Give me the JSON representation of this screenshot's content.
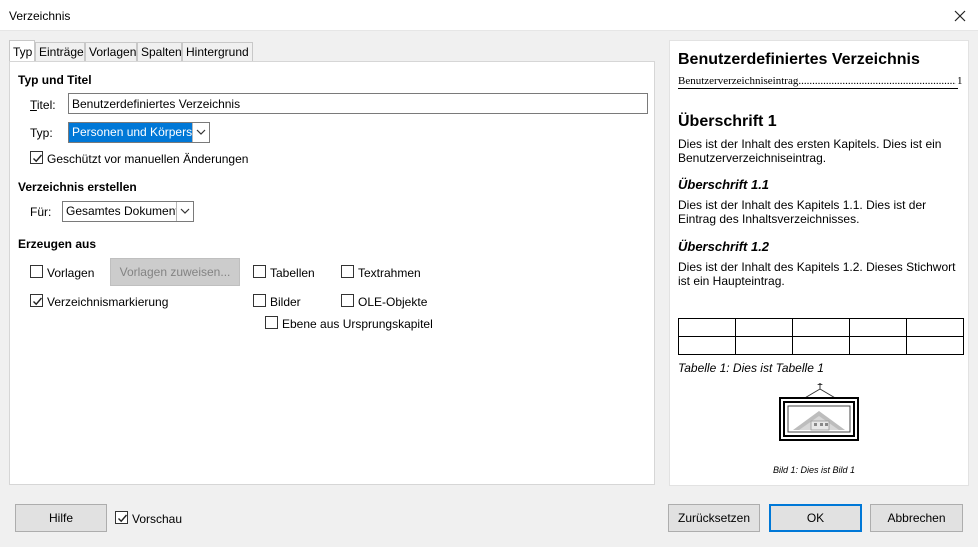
{
  "window": {
    "title": "Verzeichnis",
    "close_icon": "close-icon"
  },
  "tabs": [
    {
      "label": "Typ",
      "active": true
    },
    {
      "label": "Einträge"
    },
    {
      "label": "Vorlagen"
    },
    {
      "label": "Spalten"
    },
    {
      "label": "Hintergrund"
    }
  ],
  "type_title": {
    "heading": "Typ und Titel",
    "title_label": "Titel:",
    "title_value": "Benutzerdefiniertes Verzeichnis",
    "type_label": "Typ:",
    "type_value": "Personen und Körperschaften",
    "protected_label": "Geschützt vor manuellen Änderungen",
    "protected_checked": true
  },
  "create": {
    "heading": "Verzeichnis erstellen",
    "for_label": "Für:",
    "for_value": "Gesamtes Dokument"
  },
  "generate": {
    "heading": "Erzeugen aus",
    "styles_label": "Vorlagen",
    "styles_checked": false,
    "assign_styles_button": "Vorlagen zuweisen...",
    "tables_label": "Tabellen",
    "tables_checked": false,
    "text_frames_label": "Textrahmen",
    "text_frames_checked": false,
    "index_marks_label": "Verzeichnismarkierung",
    "index_marks_checked": true,
    "graphics_label": "Bilder",
    "graphics_checked": false,
    "ole_label": "OLE-Objekte",
    "ole_checked": false,
    "level_from_source_label": "Ebene aus Ursprungskapitel",
    "level_from_source_checked": false
  },
  "preview": {
    "title": "Benutzerdefiniertes Verzeichnis",
    "entry_text": "Benutzerverzeichniseintrag",
    "entry_page": "1",
    "h1": "Überschrift 1",
    "p1": "Dies ist der Inhalt des ersten Kapitels. Dies ist ein Benutzerverzeichniseintrag.",
    "h11": "Überschrift 1.1",
    "p11": "Dies ist der Inhalt des Kapitels 1.1. Dies ist der Eintrag des Inhaltsverzeichnisses.",
    "h12": "Überschrift 1.2",
    "p12": "Dies ist der Inhalt des Kapitels 1.2. Dieses Stichwort ist ein Haupteintrag.",
    "table_caption": "Tabelle 1: Dies ist Tabelle 1",
    "image_caption": "Bild 1: Dies ist Bild 1",
    "image_icon": "framed-picture-icon"
  },
  "footer": {
    "help_button": "Hilfe",
    "preview_label": "Vorschau",
    "preview_checked": true,
    "reset_button": "Zurücksetzen",
    "ok_button": "OK",
    "cancel_button": "Abbrechen"
  }
}
